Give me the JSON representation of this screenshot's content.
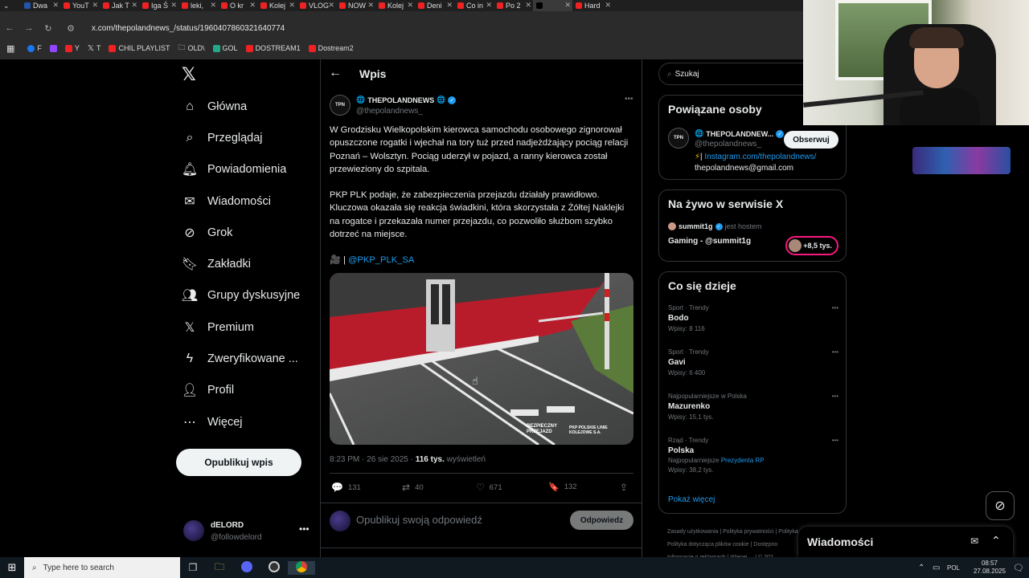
{
  "browser": {
    "tabs": [
      "Dwa",
      "YouT",
      "Jak T",
      "Iga Ś",
      "leki,",
      "O kr",
      "Kolej",
      "VLOG",
      "NOW",
      "Kolej",
      "Deni",
      "Co in",
      "Po 2",
      "",
      "Hard"
    ],
    "url": "x.com/thepolandnews_/status/1960407860321640774",
    "bookmarks": [
      "F",
      "",
      "Y",
      "T",
      "CHIL PLAYLIST",
      "OLD\\",
      "GOL",
      "DOSTREAM1",
      "Dostream2"
    ]
  },
  "nav": {
    "items": [
      "Główna",
      "Przeglądaj",
      "Powiadomienia",
      "Wiadomości",
      "Grok",
      "Zakładki",
      "Grupy dyskusyjne",
      "Premium",
      "Zweryfikowane ...",
      "Profil",
      "Więcej"
    ],
    "post_button": "Opublikuj wpis",
    "me_name": "dELORD",
    "me_handle": "@followdelord"
  },
  "header": {
    "title": "Wpis"
  },
  "tweet": {
    "avatar": "TPN",
    "author": "THEPOLANDNEWS",
    "handle": "@thepolandnews_",
    "para1": "W Grodzisku Wielkopolskim kierowca samochodu osobowego zignorował opuszczone rogatki i wjechał na tory tuż przed nadjeżdżający pociąg relacji Poznań – Wolsztyn. Pociąg uderzył w pojazd, a ranny kierowca został przewieziony do szpitala.",
    "para2": "PKP PLK podaje, że zabezpieczenia przejazdu działały prawidłowo. Kluczowa okazała się reakcja świadkini, która skorzystała z Żółtej Naklejki na rogatce i przekazała numer przejazdu, co pozwoliło służbom szybko dotrzeć na miejsce.",
    "camera_prefix": "🎥 |",
    "mention": "@PKP_PLK_SA",
    "video_logo1": "BEZPIECZNY PRZEJAZD",
    "video_logo2": "PKP POLSKIE LINIE KOLEJOWE S.A.",
    "time": "8:23 PM · 26 sie 2025 ·",
    "views": "116 tys.",
    "views_label": "wyświetleń",
    "replies": "131",
    "reposts": "40",
    "likes": "671",
    "bookmarks": "132",
    "reply_placeholder": "Opublikuj swoją odpowiedź",
    "reply_button": "Odpowiedz"
  },
  "search": {
    "placeholder": "Szukaj"
  },
  "related": {
    "title": "Powiązane osoby",
    "name": "THEPOLANDNEW...",
    "handle": "@thepolandnews_",
    "follow": "Obserwuj",
    "bio_link": "Instagram.com/thepolandnews/",
    "email": "thepolandnews@gmail.com"
  },
  "live": {
    "title": "Na żywo w serwisie X",
    "host": "summit1g",
    "host_suffix": "jest hostem",
    "stream": "Gaming - @summit1g",
    "viewers": "+8,5 tys."
  },
  "trends": {
    "title": "Co się dzieje",
    "items": [
      {
        "cat": "Sport · Trendy",
        "name": "Bodo",
        "count": "Wpisy: 8 116",
        "extra": "",
        "extra_link": ""
      },
      {
        "cat": "Sport · Trendy",
        "name": "Gavi",
        "count": "Wpisy: 6 400",
        "extra": "",
        "extra_link": ""
      },
      {
        "cat": "Najpopularniejsze w Polska",
        "name": "Mazurenko",
        "count": "Wpisy: 15,1 tys.",
        "extra": "",
        "extra_link": ""
      },
      {
        "cat": "Rząd · Trendy",
        "name": "Polska",
        "count": "Wpisy: 38,2 tys.",
        "extra": "Najpopularniejsze",
        "extra_link": "Prezydenta RP"
      }
    ],
    "more": "Pokaż więcej"
  },
  "footer": {
    "line1a": "Zasady użytkowania",
    "line1b": "Polityka prywatności",
    "line1c": "Polityka",
    "line2a": "Polityka dotycząca plików cookie",
    "line2b": "Dostępno",
    "line3a": "Informacje o reklamach",
    "line3b": "Więcej ...",
    "line3c": "© 202"
  },
  "messages_dock": {
    "title": "Wiadomości"
  },
  "taskbar": {
    "search": "Type here to search",
    "lang": "POL",
    "time": "08:57",
    "date": "27.08.2025"
  }
}
